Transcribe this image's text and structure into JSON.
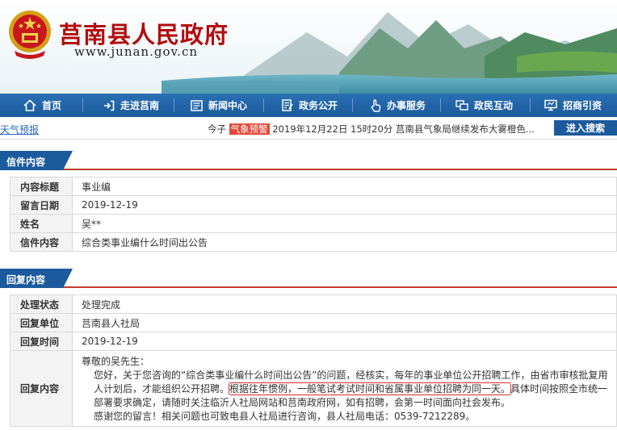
{
  "header": {
    "site_title": "莒南县人民政府",
    "site_url": "www.junan.gov.cn"
  },
  "nav": {
    "items": [
      {
        "label": "首页",
        "icon": "home-icon"
      },
      {
        "label": "走进莒南",
        "icon": "login-arrow-icon"
      },
      {
        "label": "新闻中心",
        "icon": "newspaper-icon"
      },
      {
        "label": "政务公开",
        "icon": "document-edit-icon"
      },
      {
        "label": "办事服务",
        "icon": "hand-pointer-icon"
      },
      {
        "label": "政民互动",
        "icon": "interaction-icon"
      },
      {
        "label": "招商引资",
        "icon": "monitor-icon"
      }
    ]
  },
  "ticker": {
    "weather_link": "天气预报",
    "prefix": "今子",
    "badge": "气象预警",
    "text": "2019年12月22日 15时20分 莒南县气象局继续发布大雾橙色...",
    "search_button": "进入搜索"
  },
  "letter": {
    "section_title": "信件内容",
    "rows": [
      {
        "label": "内容标题",
        "value": "事业编"
      },
      {
        "label": "留言日期",
        "value": "2019-12-19"
      },
      {
        "label": "姓名",
        "value": "吴**"
      },
      {
        "label": "信件内容",
        "value": "综合类事业编什么时间出公告"
      }
    ]
  },
  "reply": {
    "section_title": "回复内容",
    "rows": [
      {
        "label": "处理状态",
        "value": "处理完成"
      },
      {
        "label": "回复单位",
        "value": "莒南县人社局"
      },
      {
        "label": "回复时间",
        "value": "2019-12-19"
      }
    ],
    "content_label": "回复内容",
    "content": {
      "greeting": "尊敬的吴先生：",
      "para1_before": "您好，关于您咨询的“综合类事业编什么时间出公告”的问题，经核实，每年的事业单位公开招聘工作，由省市审核批复用人计划后，才能组织公开招聘。",
      "para1_highlight": "根据往年惯例，一般笔试考试时间和省属事业单位招聘为同一天。",
      "para1_after": "具体时间按照全市统一部署要求确定，请随时关注临沂人社局网站和莒南政府网，如有招聘，会第一时间面向社会发布。",
      "closing": "感谢您的留言！相关问题也可致电县人社局进行咨询，县人社局电话：0539-7212289。"
    }
  },
  "colors": {
    "nav_blue": "#1b5a9c",
    "title_red": "#b30d0d",
    "section_rule_red": "#c63b2b",
    "alert_red": "#e04a3a"
  }
}
